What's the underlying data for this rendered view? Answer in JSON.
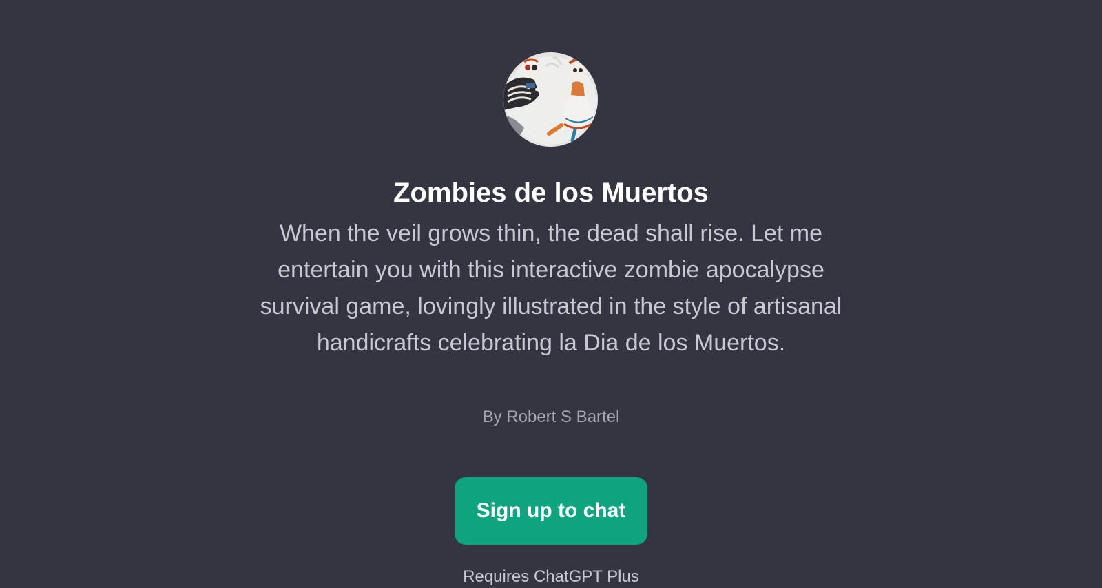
{
  "gpt": {
    "name": "Zombies de los Muertos",
    "description": "When the veil grows thin, the dead shall rise. Let me entertain you with this interactive zombie apocalypse survival game, lovingly illustrated in the style of artisanal handicrafts celebrating la Dia de los Muertos.",
    "author": "By Robert S Bartel",
    "avatar_icon": "skeleton-figures-avatar"
  },
  "actions": {
    "signup_label": "Sign up to chat"
  },
  "footer": {
    "text": "Requires ChatGPT Plus"
  },
  "colors": {
    "background": "#343541",
    "accent": "#10a37f",
    "title": "#ffffff",
    "text": "#c8c8d0"
  }
}
